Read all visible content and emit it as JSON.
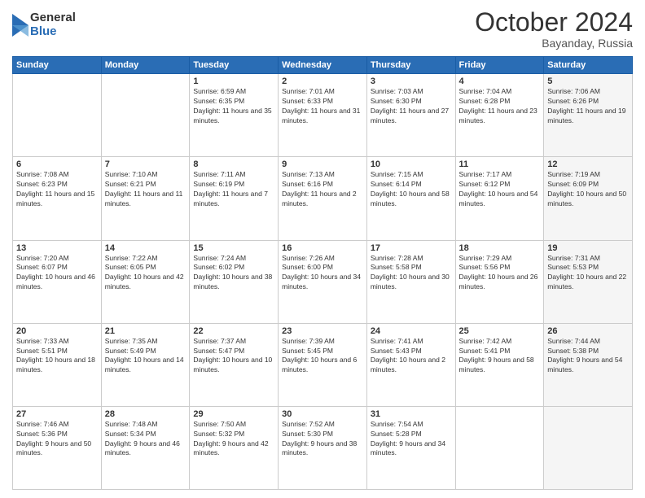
{
  "header": {
    "logo_general": "General",
    "logo_blue": "Blue",
    "title": "October 2024",
    "location": "Bayanday, Russia"
  },
  "days_of_week": [
    "Sunday",
    "Monday",
    "Tuesday",
    "Wednesday",
    "Thursday",
    "Friday",
    "Saturday"
  ],
  "weeks": [
    [
      {
        "day": "",
        "info": "",
        "shaded": false
      },
      {
        "day": "",
        "info": "",
        "shaded": false
      },
      {
        "day": "1",
        "info": "Sunrise: 6:59 AM\nSunset: 6:35 PM\nDaylight: 11 hours and 35 minutes.",
        "shaded": false
      },
      {
        "day": "2",
        "info": "Sunrise: 7:01 AM\nSunset: 6:33 PM\nDaylight: 11 hours and 31 minutes.",
        "shaded": false
      },
      {
        "day": "3",
        "info": "Sunrise: 7:03 AM\nSunset: 6:30 PM\nDaylight: 11 hours and 27 minutes.",
        "shaded": false
      },
      {
        "day": "4",
        "info": "Sunrise: 7:04 AM\nSunset: 6:28 PM\nDaylight: 11 hours and 23 minutes.",
        "shaded": false
      },
      {
        "day": "5",
        "info": "Sunrise: 7:06 AM\nSunset: 6:26 PM\nDaylight: 11 hours and 19 minutes.",
        "shaded": true
      }
    ],
    [
      {
        "day": "6",
        "info": "Sunrise: 7:08 AM\nSunset: 6:23 PM\nDaylight: 11 hours and 15 minutes.",
        "shaded": false
      },
      {
        "day": "7",
        "info": "Sunrise: 7:10 AM\nSunset: 6:21 PM\nDaylight: 11 hours and 11 minutes.",
        "shaded": false
      },
      {
        "day": "8",
        "info": "Sunrise: 7:11 AM\nSunset: 6:19 PM\nDaylight: 11 hours and 7 minutes.",
        "shaded": false
      },
      {
        "day": "9",
        "info": "Sunrise: 7:13 AM\nSunset: 6:16 PM\nDaylight: 11 hours and 2 minutes.",
        "shaded": false
      },
      {
        "day": "10",
        "info": "Sunrise: 7:15 AM\nSunset: 6:14 PM\nDaylight: 10 hours and 58 minutes.",
        "shaded": false
      },
      {
        "day": "11",
        "info": "Sunrise: 7:17 AM\nSunset: 6:12 PM\nDaylight: 10 hours and 54 minutes.",
        "shaded": false
      },
      {
        "day": "12",
        "info": "Sunrise: 7:19 AM\nSunset: 6:09 PM\nDaylight: 10 hours and 50 minutes.",
        "shaded": true
      }
    ],
    [
      {
        "day": "13",
        "info": "Sunrise: 7:20 AM\nSunset: 6:07 PM\nDaylight: 10 hours and 46 minutes.",
        "shaded": false
      },
      {
        "day": "14",
        "info": "Sunrise: 7:22 AM\nSunset: 6:05 PM\nDaylight: 10 hours and 42 minutes.",
        "shaded": false
      },
      {
        "day": "15",
        "info": "Sunrise: 7:24 AM\nSunset: 6:02 PM\nDaylight: 10 hours and 38 minutes.",
        "shaded": false
      },
      {
        "day": "16",
        "info": "Sunrise: 7:26 AM\nSunset: 6:00 PM\nDaylight: 10 hours and 34 minutes.",
        "shaded": false
      },
      {
        "day": "17",
        "info": "Sunrise: 7:28 AM\nSunset: 5:58 PM\nDaylight: 10 hours and 30 minutes.",
        "shaded": false
      },
      {
        "day": "18",
        "info": "Sunrise: 7:29 AM\nSunset: 5:56 PM\nDaylight: 10 hours and 26 minutes.",
        "shaded": false
      },
      {
        "day": "19",
        "info": "Sunrise: 7:31 AM\nSunset: 5:53 PM\nDaylight: 10 hours and 22 minutes.",
        "shaded": true
      }
    ],
    [
      {
        "day": "20",
        "info": "Sunrise: 7:33 AM\nSunset: 5:51 PM\nDaylight: 10 hours and 18 minutes.",
        "shaded": false
      },
      {
        "day": "21",
        "info": "Sunrise: 7:35 AM\nSunset: 5:49 PM\nDaylight: 10 hours and 14 minutes.",
        "shaded": false
      },
      {
        "day": "22",
        "info": "Sunrise: 7:37 AM\nSunset: 5:47 PM\nDaylight: 10 hours and 10 minutes.",
        "shaded": false
      },
      {
        "day": "23",
        "info": "Sunrise: 7:39 AM\nSunset: 5:45 PM\nDaylight: 10 hours and 6 minutes.",
        "shaded": false
      },
      {
        "day": "24",
        "info": "Sunrise: 7:41 AM\nSunset: 5:43 PM\nDaylight: 10 hours and 2 minutes.",
        "shaded": false
      },
      {
        "day": "25",
        "info": "Sunrise: 7:42 AM\nSunset: 5:41 PM\nDaylight: 9 hours and 58 minutes.",
        "shaded": false
      },
      {
        "day": "26",
        "info": "Sunrise: 7:44 AM\nSunset: 5:38 PM\nDaylight: 9 hours and 54 minutes.",
        "shaded": true
      }
    ],
    [
      {
        "day": "27",
        "info": "Sunrise: 7:46 AM\nSunset: 5:36 PM\nDaylight: 9 hours and 50 minutes.",
        "shaded": false
      },
      {
        "day": "28",
        "info": "Sunrise: 7:48 AM\nSunset: 5:34 PM\nDaylight: 9 hours and 46 minutes.",
        "shaded": false
      },
      {
        "day": "29",
        "info": "Sunrise: 7:50 AM\nSunset: 5:32 PM\nDaylight: 9 hours and 42 minutes.",
        "shaded": false
      },
      {
        "day": "30",
        "info": "Sunrise: 7:52 AM\nSunset: 5:30 PM\nDaylight: 9 hours and 38 minutes.",
        "shaded": false
      },
      {
        "day": "31",
        "info": "Sunrise: 7:54 AM\nSunset: 5:28 PM\nDaylight: 9 hours and 34 minutes.",
        "shaded": false
      },
      {
        "day": "",
        "info": "",
        "shaded": false
      },
      {
        "day": "",
        "info": "",
        "shaded": true
      }
    ]
  ]
}
